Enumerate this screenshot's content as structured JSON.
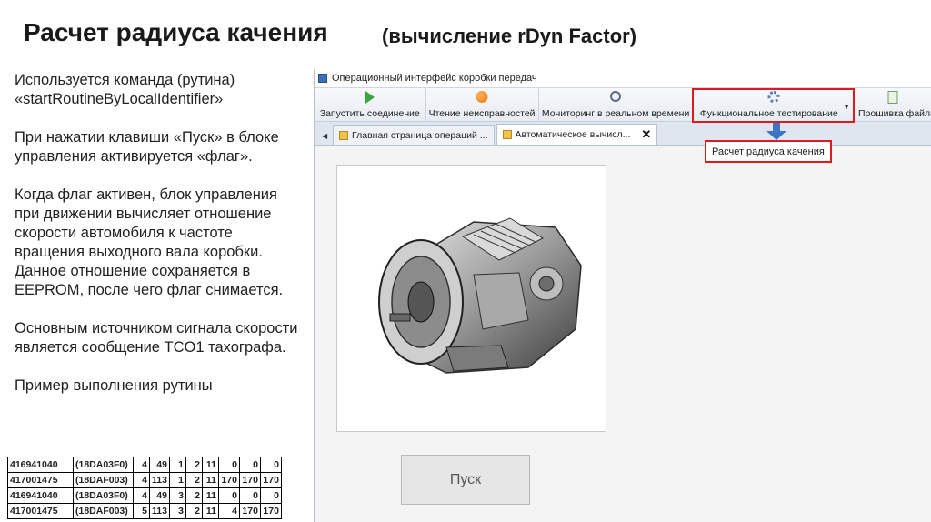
{
  "slide": {
    "title": "Расчет радиуса качения",
    "subtitle": "(вычисление rDyn Factor)",
    "paragraphs": [
      "Используется команда (рутина) «startRoutineByLocalIdentifier»",
      "При нажатии клавиши «Пуск» в блоке управления активируется «флаг».",
      "Когда флаг активен, блок управления при движении вычисляет отношение скорости автомобиля к частоте вращения выходного вала коробки. Данное отношение сохраняется в EEPROM, после чего флаг снимается.",
      "Основным источником сигнала скорости является сообщение TCO1 тахографа.",
      "Пример выполнения рутины"
    ]
  },
  "log_table": {
    "rows": [
      [
        "416941040",
        "(18DA03F0)",
        "4",
        "49",
        "1",
        "2",
        "11",
        "0",
        "0",
        "0"
      ],
      [
        "417001475",
        "(18DAF003)",
        "4",
        "113",
        "1",
        "2",
        "11",
        "170",
        "170",
        "170"
      ],
      [
        "416941040",
        "(18DA03F0)",
        "4",
        "49",
        "3",
        "2",
        "11",
        "0",
        "0",
        "0"
      ],
      [
        "417001475",
        "(18DAF003)",
        "5",
        "113",
        "3",
        "2",
        "11",
        "4",
        "170",
        "170"
      ]
    ]
  },
  "app": {
    "window_title": "Операционный интерфейс коробки передач",
    "toolbar": {
      "connect": "Запустить соединение",
      "read_faults": "Чтение неисправностей",
      "monitoring": "Мониторинг в реальном времени",
      "functional_testing": "Функциональное тестирование",
      "flashing": "Прошивка файла"
    },
    "tabs": {
      "main_page": "Главная страница операций ...",
      "auto_calc": "Автоматическое вычисл..."
    },
    "dropdown_item": "Расчет радиуса качения",
    "start_button": "Пуск",
    "colors": {
      "highlight": "#e0191f",
      "arrow": "#3e73c6",
      "play": "#3aa53a"
    }
  }
}
